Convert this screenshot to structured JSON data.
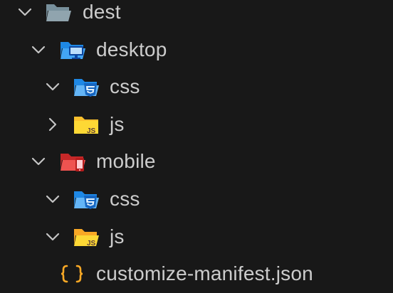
{
  "explorer": {
    "items": [
      {
        "label": "dest",
        "expanded": true,
        "icon": "folder-open-gray-icon"
      },
      {
        "label": "desktop",
        "expanded": true,
        "icon": "folder-desktop-icon"
      },
      {
        "label": "css",
        "expanded": true,
        "icon": "folder-css-icon"
      },
      {
        "label": "js",
        "expanded": false,
        "icon": "folder-js-icon"
      },
      {
        "label": "mobile",
        "expanded": true,
        "icon": "folder-mobile-icon"
      },
      {
        "label": "css",
        "expanded": true,
        "icon": "folder-css-icon"
      },
      {
        "label": "js",
        "expanded": true,
        "icon": "folder-js-icon"
      },
      {
        "label": "customize-manifest.json",
        "icon": "json-file-icon"
      }
    ]
  },
  "colors": {
    "background": "#181818",
    "text": "#cccccc",
    "chevron": "#c5c5c5",
    "folder_gray": "#90a4ae",
    "folder_blue": "#42a5f5",
    "folder_css": "#64b5f6",
    "folder_js": "#fbc02d",
    "folder_red": "#ef5350",
    "json_brace": "#f9a825"
  }
}
